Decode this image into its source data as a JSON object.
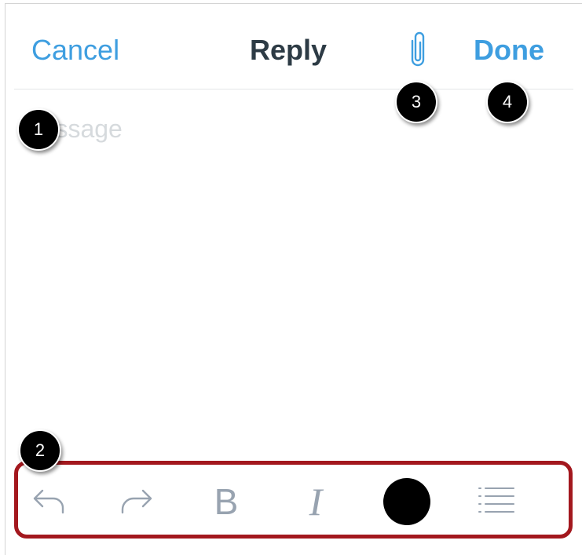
{
  "nav": {
    "cancel_label": "Cancel",
    "title": "Reply",
    "done_label": "Done",
    "attach_icon": "paperclip-icon"
  },
  "compose": {
    "placeholder": "Message"
  },
  "toolbar": {
    "tools": [
      "undo-icon",
      "redo-icon",
      "bold-icon",
      "italic-icon",
      "text-color-icon",
      "list-icon"
    ],
    "bold_glyph": "B",
    "italic_glyph": "I",
    "text_color": "#000000"
  },
  "callouts": [
    "1",
    "2",
    "3",
    "4"
  ],
  "colors": {
    "accent": "#3e9ee0",
    "title": "#2d3b45",
    "highlight_border": "#a3181e",
    "tool_icon": "#98a3b0"
  }
}
